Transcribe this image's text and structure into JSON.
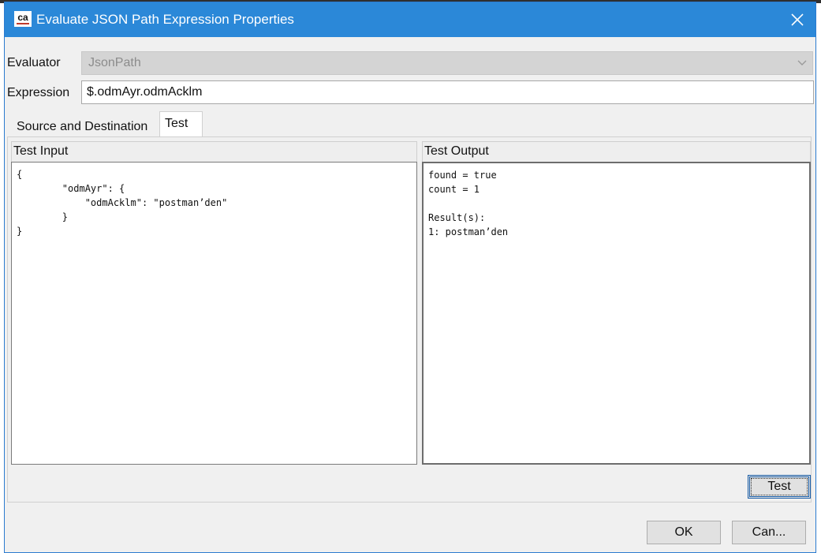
{
  "window": {
    "title": "Evaluate JSON Path Expression Properties",
    "app_icon": "ca-technologies-logo",
    "app_icon_text": "ca",
    "close_icon": "close-icon"
  },
  "form": {
    "evaluator_label": "Evaluator",
    "evaluator_value": "JsonPath",
    "expression_label": "Expression",
    "expression_value": "$.odmAyr.odmAcklm"
  },
  "tabs": [
    {
      "label": "Source and Destination",
      "active": false
    },
    {
      "label": "Test",
      "active": true
    }
  ],
  "test_tab": {
    "input_header": "Test Input",
    "input_text": "{\n        \"odmAyr\": {\n            \"odmAcklm\": \"postman’den\"\n        }\n}",
    "output_header": "Test Output",
    "output_text": "found = true\ncount = 1\n\nResult(s):\n1: postman’den",
    "test_button": "Test"
  },
  "footer": {
    "ok_button": "OK",
    "cancel_button": "Can..."
  },
  "colors": {
    "titlebar": "#2b88d8",
    "dialog_bg": "#f0f0f0"
  }
}
